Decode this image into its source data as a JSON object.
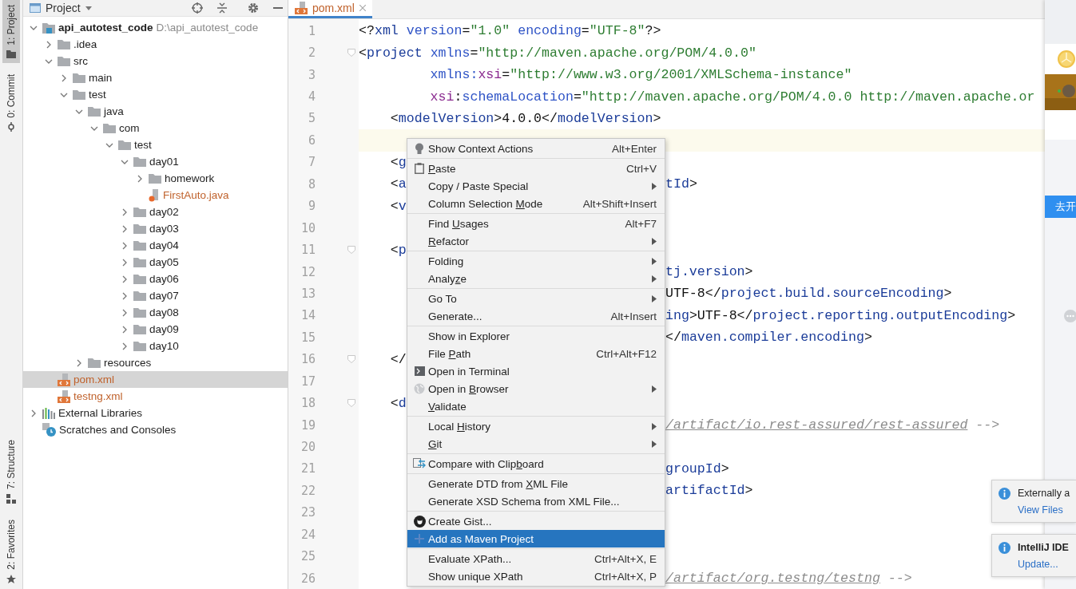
{
  "toolstrip": {
    "top": [
      {
        "label": "1: Project",
        "kind": "folder",
        "selected": true
      },
      {
        "label": "0: Commit",
        "kind": "commit",
        "selected": false
      }
    ],
    "bottom": [
      {
        "label": "7: Structure",
        "kind": "structure",
        "selected": false
      },
      {
        "label": "2: Favorites",
        "kind": "star",
        "selected": false
      }
    ]
  },
  "project": {
    "title": "Project",
    "tree": [
      {
        "kind": "module",
        "label": "api_autotest_code",
        "path": "D:\\api_autotest_code",
        "expanded": true,
        "selected": false,
        "children": [
          {
            "kind": "folder",
            "label": ".idea",
            "expanded": false,
            "selected": false
          },
          {
            "kind": "folder",
            "label": "src",
            "expanded": true,
            "selected": false,
            "children": [
              {
                "kind": "folder",
                "label": "main",
                "expanded": false,
                "selected": false
              },
              {
                "kind": "folder",
                "label": "test",
                "expanded": true,
                "selected": false,
                "children": [
                  {
                    "kind": "folder",
                    "label": "java",
                    "expanded": true,
                    "selected": false,
                    "children": [
                      {
                        "kind": "folder",
                        "label": "com",
                        "expanded": true,
                        "selected": false,
                        "children": [
                          {
                            "kind": "folder",
                            "label": "test",
                            "expanded": true,
                            "selected": false,
                            "children": [
                              {
                                "kind": "folder",
                                "label": "day01",
                                "expanded": true,
                                "selected": false,
                                "children": [
                                  {
                                    "kind": "folder",
                                    "label": "homework",
                                    "expanded": false,
                                    "selected": false
                                  },
                                  {
                                    "kind": "java",
                                    "label": "FirstAuto.java",
                                    "selected": false,
                                    "color": "#c0622c"
                                  }
                                ]
                              },
                              {
                                "kind": "folder",
                                "label": "day02",
                                "expanded": false,
                                "selected": false
                              },
                              {
                                "kind": "folder",
                                "label": "day03",
                                "expanded": false,
                                "selected": false
                              },
                              {
                                "kind": "folder",
                                "label": "day04",
                                "expanded": false,
                                "selected": false
                              },
                              {
                                "kind": "folder",
                                "label": "day05",
                                "expanded": false,
                                "selected": false
                              },
                              {
                                "kind": "folder",
                                "label": "day06",
                                "expanded": false,
                                "selected": false
                              },
                              {
                                "kind": "folder",
                                "label": "day07",
                                "expanded": false,
                                "selected": false
                              },
                              {
                                "kind": "folder",
                                "label": "day08",
                                "expanded": false,
                                "selected": false
                              },
                              {
                                "kind": "folder",
                                "label": "day09",
                                "expanded": false,
                                "selected": false
                              },
                              {
                                "kind": "folder",
                                "label": "day10",
                                "expanded": false,
                                "selected": false
                              }
                            ]
                          }
                        ]
                      }
                    ]
                  },
                  {
                    "kind": "folder",
                    "label": "resources",
                    "expanded": false,
                    "selected": false
                  }
                ]
              }
            ]
          },
          {
            "kind": "xml",
            "label": "pom.xml",
            "selected": true,
            "color": "#c0622c"
          },
          {
            "kind": "xml",
            "label": "testng.xml",
            "selected": false,
            "color": "#c0622c"
          }
        ]
      },
      {
        "kind": "libraries",
        "label": "External Libraries",
        "expanded": false,
        "selected": false
      },
      {
        "kind": "scratches",
        "label": "Scratches and Consoles",
        "selected": false
      }
    ]
  },
  "editor": {
    "tabs": [
      {
        "label": "pom.xml",
        "kind": "xml",
        "selected": true
      }
    ],
    "lines": [
      {
        "number": "1",
        "current": false,
        "fold": false,
        "left": [
          {
            "kind": "punct",
            "text": "<?"
          },
          {
            "kind": "tag",
            "text": "xml"
          },
          {
            "kind": "attr",
            "text": " version"
          },
          {
            "kind": "punct",
            "text": "="
          },
          {
            "kind": "str",
            "text": "\"1.0\""
          },
          {
            "kind": "attr",
            "text": " encoding"
          },
          {
            "kind": "punct",
            "text": "="
          },
          {
            "kind": "str",
            "text": "\"UTF-8\""
          },
          {
            "kind": "punct",
            "text": "?>"
          }
        ]
      },
      {
        "number": "2",
        "current": false,
        "fold": true,
        "left": [
          {
            "kind": "punct",
            "text": "<"
          },
          {
            "kind": "tag",
            "text": "project"
          },
          {
            "kind": "attr",
            "text": " xmlns"
          },
          {
            "kind": "punct",
            "text": "="
          },
          {
            "kind": "str",
            "text": "\"http://maven.apache.org/POM/4.0.0\""
          }
        ]
      },
      {
        "number": "3",
        "current": false,
        "fold": false,
        "left": [
          {
            "kind": "attr",
            "text": "         xmlns:"
          },
          {
            "kind": "ns",
            "text": "xsi"
          },
          {
            "kind": "punct",
            "text": "="
          },
          {
            "kind": "str",
            "text": "\"http://www.w3.org/2001/XMLSchema-instance\""
          }
        ]
      },
      {
        "number": "4",
        "current": false,
        "fold": false,
        "left": [
          {
            "kind": "ns",
            "text": "         xsi"
          },
          {
            "kind": "punct",
            "text": ":"
          },
          {
            "kind": "attr",
            "text": "schemaLocation"
          },
          {
            "kind": "punct",
            "text": "="
          },
          {
            "kind": "str",
            "text": "\"http://maven.apache.org/POM/4.0.0 http://maven.apache.or"
          }
        ]
      },
      {
        "number": "5",
        "current": false,
        "fold": false,
        "left": [
          {
            "kind": "punct",
            "text": "    <"
          },
          {
            "kind": "tag",
            "text": "modelVersion"
          },
          {
            "kind": "punct",
            "text": ">4.0.0</"
          },
          {
            "kind": "tag",
            "text": "modelVersion"
          },
          {
            "kind": "punct",
            "text": ">"
          }
        ]
      },
      {
        "number": "6",
        "current": true,
        "fold": false
      },
      {
        "number": "7",
        "current": false,
        "fold": false,
        "left": [
          {
            "kind": "punct",
            "text": "    <"
          },
          {
            "kind": "tag",
            "text": "g"
          }
        ]
      },
      {
        "number": "8",
        "current": false,
        "fold": false,
        "left": [
          {
            "kind": "punct",
            "text": "    <"
          },
          {
            "kind": "tag",
            "text": "a"
          }
        ],
        "right": [
          {
            "kind": "tag",
            "text": "tId"
          },
          {
            "kind": "punct",
            "text": ">"
          }
        ]
      },
      {
        "number": "9",
        "current": false,
        "fold": false,
        "left": [
          {
            "kind": "punct",
            "text": "    <"
          },
          {
            "kind": "tag",
            "text": "v"
          }
        ]
      },
      {
        "number": "10",
        "current": false,
        "fold": false
      },
      {
        "number": "11",
        "current": false,
        "fold": true,
        "left": [
          {
            "kind": "punct",
            "text": "    <"
          },
          {
            "kind": "tag",
            "text": "p"
          }
        ]
      },
      {
        "number": "12",
        "current": false,
        "fold": false,
        "right": [
          {
            "kind": "tag",
            "text": "tj.version"
          },
          {
            "kind": "punct",
            "text": ">"
          }
        ]
      },
      {
        "number": "13",
        "current": false,
        "fold": false,
        "right": [
          {
            "kind": "punct",
            "text": "UTF-8</"
          },
          {
            "kind": "tag",
            "text": "project.build.sourceEncoding"
          },
          {
            "kind": "punct",
            "text": ">"
          }
        ]
      },
      {
        "number": "14",
        "current": false,
        "fold": false,
        "right": [
          {
            "kind": "tag",
            "text": "ing"
          },
          {
            "kind": "punct",
            "text": ">UTF-8</"
          },
          {
            "kind": "tag",
            "text": "project.reporting.outputEncoding"
          },
          {
            "kind": "punct",
            "text": ">"
          }
        ]
      },
      {
        "number": "15",
        "current": false,
        "fold": false,
        "right": [
          {
            "kind": "punct",
            "text": "</"
          },
          {
            "kind": "tag",
            "text": "maven.compiler.encoding"
          },
          {
            "kind": "punct",
            "text": ">"
          }
        ]
      },
      {
        "number": "16",
        "current": false,
        "fold": true,
        "left": [
          {
            "kind": "punct",
            "text": "    </"
          }
        ]
      },
      {
        "number": "17",
        "current": false,
        "fold": false
      },
      {
        "number": "18",
        "current": false,
        "fold": true,
        "left": [
          {
            "kind": "punct",
            "text": "    <"
          },
          {
            "kind": "tag",
            "text": "d"
          }
        ]
      },
      {
        "number": "19",
        "current": false,
        "fold": false,
        "right": [
          {
            "kind": "url",
            "text": "/artifact/io.rest-assured/rest-assured"
          },
          {
            "kind": "comment",
            "text": " -->"
          }
        ]
      },
      {
        "number": "20",
        "current": false,
        "fold": false
      },
      {
        "number": "21",
        "current": false,
        "fold": false,
        "right": [
          {
            "kind": "tag",
            "text": "groupId"
          },
          {
            "kind": "punct",
            "text": ">"
          }
        ]
      },
      {
        "number": "22",
        "current": false,
        "fold": false,
        "right": [
          {
            "kind": "tag",
            "text": "artifactId"
          },
          {
            "kind": "punct",
            "text": ">"
          }
        ]
      },
      {
        "number": "23",
        "current": false,
        "fold": false
      },
      {
        "number": "24",
        "current": false,
        "fold": false
      },
      {
        "number": "25",
        "current": false,
        "fold": false
      },
      {
        "number": "26",
        "current": false,
        "fold": false,
        "right": [
          {
            "kind": "url",
            "text": "/artifact/org.testng/testng"
          },
          {
            "kind": "comment",
            "text": " -->"
          }
        ]
      }
    ]
  },
  "context_menu": {
    "groups": [
      [
        {
          "label": "Show Context Actions",
          "kind": "bulb",
          "shortcut": "Alt+Enter",
          "submenu": false,
          "selected": false
        }
      ],
      [
        {
          "label": [
            {
              "text": "P",
              "underlined": true
            },
            {
              "text": "aste",
              "underlined": false
            }
          ],
          "kind": "paste",
          "shortcut": "Ctrl+V",
          "submenu": false,
          "selected": false
        },
        {
          "label": "Copy / Paste Special",
          "kind": "plain",
          "submenu": true,
          "selected": false
        },
        {
          "label": [
            {
              "text": "Column Selection ",
              "underlined": false
            },
            {
              "text": "M",
              "underlined": true
            },
            {
              "text": "ode",
              "underlined": false
            }
          ],
          "kind": "plain",
          "shortcut": "Alt+Shift+Insert",
          "submenu": false,
          "selected": false
        }
      ],
      [
        {
          "label": [
            {
              "text": "Find ",
              "underlined": false
            },
            {
              "text": "U",
              "underlined": true
            },
            {
              "text": "sages",
              "underlined": false
            }
          ],
          "kind": "plain",
          "shortcut": "Alt+F7",
          "submenu": false,
          "selected": false
        },
        {
          "label": [
            {
              "text": "R",
              "underlined": true
            },
            {
              "text": "efactor",
              "underlined": false
            }
          ],
          "kind": "plain",
          "submenu": true,
          "selected": false
        }
      ],
      [
        {
          "label": "Folding",
          "kind": "plain",
          "submenu": true,
          "selected": false
        },
        {
          "label": [
            {
              "text": "Analy",
              "underlined": false
            },
            {
              "text": "z",
              "underlined": true
            },
            {
              "text": "e",
              "underlined": false
            }
          ],
          "kind": "plain",
          "submenu": true,
          "selected": false
        }
      ],
      [
        {
          "label": "Go To",
          "kind": "plain",
          "submenu": true,
          "selected": false
        },
        {
          "label": "Generate...",
          "kind": "plain",
          "shortcut": "Alt+Insert",
          "submenu": false,
          "selected": false
        }
      ],
      [
        {
          "label": "Show in Explorer",
          "kind": "plain",
          "submenu": false,
          "selected": false
        },
        {
          "label": [
            {
              "text": "File ",
              "underlined": false
            },
            {
              "text": "P",
              "underlined": true
            },
            {
              "text": "ath",
              "underlined": false
            }
          ],
          "kind": "plain",
          "shortcut": "Ctrl+Alt+F12",
          "submenu": false,
          "selected": false
        },
        {
          "label": "Open in Terminal",
          "kind": "terminal",
          "submenu": false,
          "selected": false
        },
        {
          "label": [
            {
              "text": "Open in ",
              "underlined": false
            },
            {
              "text": "B",
              "underlined": true
            },
            {
              "text": "rowser",
              "underlined": false
            }
          ],
          "kind": "globe",
          "submenu": true,
          "selected": false
        },
        {
          "label": [
            {
              "text": "V",
              "underlined": true
            },
            {
              "text": "alidate",
              "underlined": false
            }
          ],
          "kind": "plain",
          "submenu": false,
          "selected": false
        }
      ],
      [
        {
          "label": [
            {
              "text": "Local ",
              "underlined": false
            },
            {
              "text": "H",
              "underlined": true
            },
            {
              "text": "istory",
              "underlined": false
            }
          ],
          "kind": "plain",
          "submenu": true,
          "selected": false
        },
        {
          "label": [
            {
              "text": "G",
              "underlined": true
            },
            {
              "text": "it",
              "underlined": false
            }
          ],
          "kind": "plain",
          "submenu": true,
          "selected": false
        }
      ],
      [
        {
          "label": [
            {
              "text": "Compare with Clip",
              "underlined": false
            },
            {
              "text": "b",
              "underlined": true
            },
            {
              "text": "oard",
              "underlined": false
            }
          ],
          "kind": "compare",
          "submenu": false,
          "selected": false
        }
      ],
      [
        {
          "label": [
            {
              "text": "Generate DTD from ",
              "underlined": false
            },
            {
              "text": "X",
              "underlined": true
            },
            {
              "text": "ML File",
              "underlined": false
            }
          ],
          "kind": "plain",
          "submenu": false,
          "selected": false
        },
        {
          "label": "Generate XSD Schema from XML File...",
          "kind": "plain",
          "submenu": false,
          "selected": false
        }
      ],
      [
        {
          "label": "Create Gist...",
          "kind": "github",
          "submenu": false,
          "selected": false
        },
        {
          "label": "Add as Maven Project",
          "kind": "plus",
          "submenu": false,
          "selected": true
        }
      ],
      [
        {
          "label": "Evaluate XPath...",
          "kind": "plain",
          "shortcut": "Ctrl+Alt+X, E",
          "submenu": false,
          "selected": false
        },
        {
          "label": "Show unique XPath",
          "kind": "plain",
          "shortcut": "Ctrl+Alt+X, P",
          "submenu": false,
          "selected": false
        }
      ]
    ]
  },
  "side_app": {
    "button": "去开"
  },
  "notifications": [
    {
      "title": "Externally a",
      "link": "View Files",
      "bold": false
    },
    {
      "title": "IntelliJ IDE",
      "link": "Update...",
      "bold": true
    }
  ]
}
